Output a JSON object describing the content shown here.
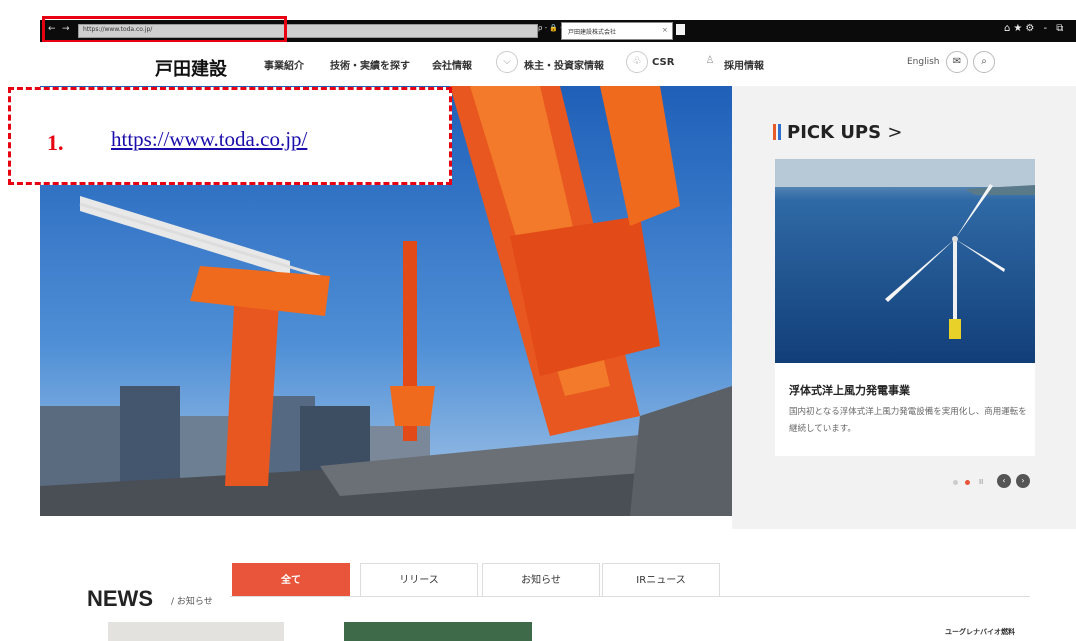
{
  "browser": {
    "address_text": "https://www.toda.co.jp/",
    "address_tools": "ρ - 🔒 C",
    "tab_label": "戸田建設株式会社",
    "tab_close": "×",
    "back": "←",
    "forward": "→",
    "right_icons": "⌂★⚙ - ⧉"
  },
  "callout": {
    "number": "1.",
    "url": "https://www.toda.co.jp/"
  },
  "header": {
    "logo": "戸田建設",
    "nav": [
      {
        "label": "事業紹介",
        "icon": ""
      },
      {
        "label": "技術・実績を探す",
        "icon": ""
      },
      {
        "label": "会社情報",
        "icon": ""
      },
      {
        "label": "株主・投資家情報",
        "icon": "chart-icon"
      },
      {
        "label": "CSR",
        "icon": "leaf-icon"
      },
      {
        "label": "採用情報",
        "icon": "person-icon"
      }
    ],
    "english": "English",
    "mail_icon": "✉",
    "search_icon": "⌕"
  },
  "pickups": {
    "title": "PICK UPS",
    "chevron": ">",
    "card_title": "浮体式洋上風力発電事業",
    "card_desc": "国内初となる浮体式洋上風力発電設備を実用化し、商用運転を継続しています。",
    "pause": "II",
    "prev": "‹",
    "next": "›"
  },
  "news": {
    "title": "NEWS",
    "subtitle": "/ お知らせ",
    "tabs": [
      "全て",
      "リリース",
      "お知らせ",
      "IRニュース"
    ],
    "active_tab": 0,
    "right_snippet": "ユーグレナバイオ燃料"
  },
  "colors": {
    "accent": "#e8553a",
    "highlight_red": "#e60012",
    "link": "#1a0dab"
  }
}
